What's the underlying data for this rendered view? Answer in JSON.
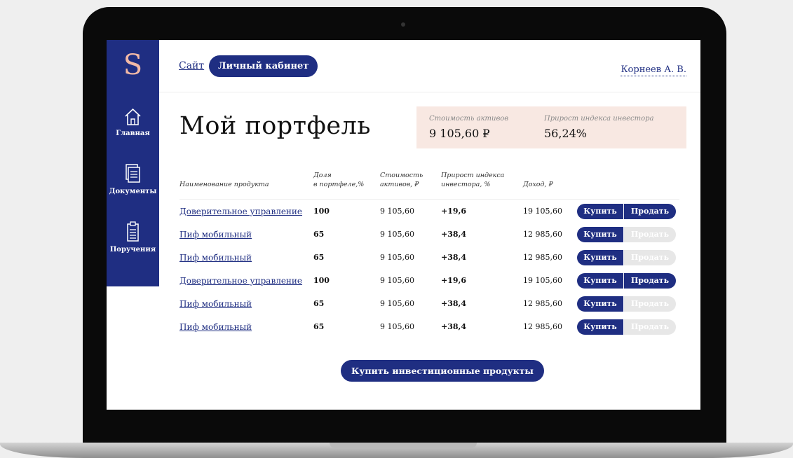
{
  "brand": {
    "logo_glyph": "S",
    "colors": {
      "primary": "#1f2e82",
      "accent": "#f2b9a6",
      "stats_bg": "#f8e8e2"
    }
  },
  "sidebar": {
    "items": [
      {
        "label": "Главная",
        "icon": "home-icon"
      },
      {
        "label": "Документы",
        "icon": "documents-icon"
      },
      {
        "label": "Поручения",
        "icon": "clipboard-icon"
      }
    ]
  },
  "header": {
    "site_link": "Сайт",
    "cabinet_button": "Личный кабинет",
    "user_name": "Корнеев А. В."
  },
  "page": {
    "title": "Мой портфель"
  },
  "stats": {
    "assets_label": "Стоимость активов",
    "assets_value": "9 105,60 ₽",
    "growth_label": "Прирост индекса инвестора",
    "growth_value": "56,24%"
  },
  "table": {
    "columns": [
      "Наименование продукта",
      "Доля\nв портфеле,%",
      "Стоимость\nактивов, ₽",
      "Прирост индекса\nинвестора, %",
      "Доход, ₽"
    ],
    "buy_label": "Купить",
    "sell_label": "Продать",
    "rows": [
      {
        "name": "Доверительное управление",
        "share": "100",
        "value": "9 105,60",
        "growth": "+19,6",
        "income": "19 105,60",
        "sell_enabled": true
      },
      {
        "name": "Пиф мобильный",
        "share": "65",
        "value": "9 105,60",
        "growth": "+38,4",
        "income": "12 985,60",
        "sell_enabled": false
      },
      {
        "name": "Пиф мобильный",
        "share": "65",
        "value": "9 105,60",
        "growth": "+38,4",
        "income": "12 985,60",
        "sell_enabled": false
      },
      {
        "name": "Доверительное управление",
        "share": "100",
        "value": "9 105,60",
        "growth": "+19,6",
        "income": "19 105,60",
        "sell_enabled": true
      },
      {
        "name": "Пиф мобильный",
        "share": "65",
        "value": "9 105,60",
        "growth": "+38,4",
        "income": "12 985,60",
        "sell_enabled": false
      },
      {
        "name": "Пиф мобильный",
        "share": "65",
        "value": "9 105,60",
        "growth": "+38,4",
        "income": "12 985,60",
        "sell_enabled": false
      }
    ]
  },
  "actions": {
    "buy_products": "Купить инвестиционные продукты"
  }
}
